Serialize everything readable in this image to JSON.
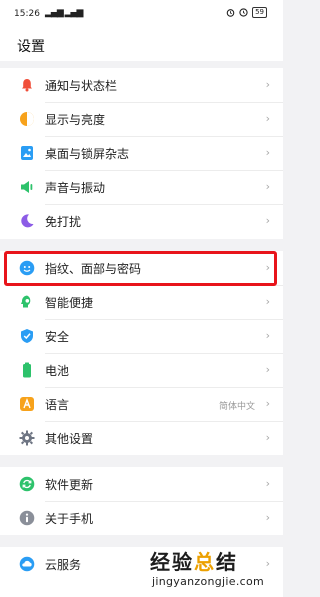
{
  "status_bar": {
    "time": "15:26",
    "signal": "▂▄▆ ▂▄▆",
    "battery": "59"
  },
  "header": {
    "title": "设置"
  },
  "groups": [
    {
      "items": [
        {
          "label": "通知与状态栏",
          "icon": "bell-icon",
          "color": "#f04e39"
        },
        {
          "label": "显示与亮度",
          "icon": "brightness-icon",
          "color": "#f7a21b"
        },
        {
          "label": "桌面与锁屏杂志",
          "icon": "wallpaper-icon",
          "color": "#2a9df4"
        },
        {
          "label": "声音与振动",
          "icon": "speaker-icon",
          "color": "#2dc26b"
        },
        {
          "label": "免打扰",
          "icon": "moon-icon",
          "color": "#8c5ce6"
        }
      ]
    },
    {
      "items": [
        {
          "label": "指纹、面部与密码",
          "icon": "face-icon",
          "color": "#2a9df4"
        },
        {
          "label": "智能便捷",
          "icon": "smart-assist-icon",
          "color": "#2dc26b"
        },
        {
          "label": "安全",
          "icon": "shield-icon",
          "color": "#2a9df4"
        },
        {
          "label": "电池",
          "icon": "battery-icon",
          "color": "#2dc26b"
        },
        {
          "label": "语言",
          "icon": "language-icon",
          "color": "#f7a21b",
          "value": "简体中文"
        },
        {
          "label": "其他设置",
          "icon": "gear-icon",
          "color": "#6e7583"
        }
      ]
    },
    {
      "items": [
        {
          "label": "软件更新",
          "icon": "update-icon",
          "color": "#2dc26b"
        },
        {
          "label": "关于手机",
          "icon": "info-icon",
          "color": "#8a8f99"
        }
      ]
    },
    {
      "items": [
        {
          "label": "云服务",
          "icon": "cloud-icon",
          "color": "#2a9df4"
        }
      ]
    }
  ],
  "chevron": "›",
  "watermark": {
    "logo_main": "经验",
    "logo_accent": "总",
    "logo_end": "结",
    "url": "jingyanzongjie.com"
  }
}
